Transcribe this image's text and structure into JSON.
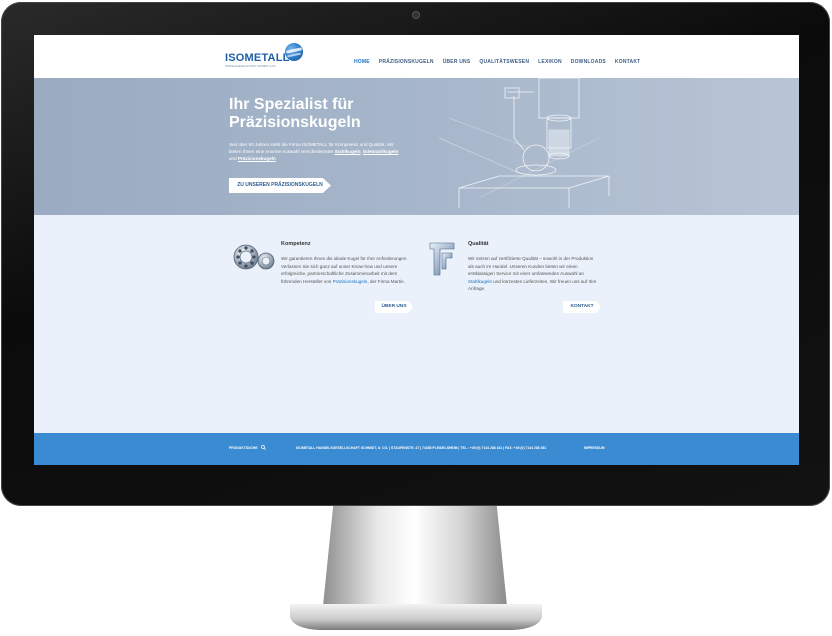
{
  "site": {
    "logo": {
      "name": "ISOMETALL",
      "tagline": "HANDELSGESELLSCHAFT SCHMIDT & CO."
    },
    "nav": [
      {
        "label": "HOME",
        "active": true
      },
      {
        "label": "PRÄZISIONSKUGELN",
        "active": false
      },
      {
        "label": "ÜBER UNS",
        "active": false
      },
      {
        "label": "QUALITÄTSWESEN",
        "active": false
      },
      {
        "label": "LEXIKON",
        "active": false
      },
      {
        "label": "DOWNLOADS",
        "active": false
      },
      {
        "label": "KONTAKT",
        "active": false
      }
    ],
    "hero": {
      "title_line1": "Ihr Spezialist für",
      "title_line2": "Präzisionskugeln",
      "text": "Seit über 50 Jahren steht die Firma ISOMETALL für Kompetenz und Qualität. Wir bieten Ihnen eine enorme Auswahl verschiedenster",
      "link1": "Stahlkugeln",
      "sep1": ", ",
      "link2": "Edelstahlkugeln",
      "sep2": " und ",
      "link3": "Präzisionskugeln",
      "end": ".",
      "button": "ZU UNSEREN PRÄZISIONSKUGELN"
    },
    "features": [
      {
        "title": "Kompetenz",
        "text_pre": "Wir garantieren Ihnen die ideale Kugel für Ihre Anforderungen. Verlassen Sie sich ganz auf unser Know-how und unsere erfolgreiche, partnerschaftliche Zusammenarbeit mit dem führenden Hersteller von ",
        "link": "Präzisionskugeln",
        "text_post": ", der Firma Martin.",
        "button": "ÜBER UNS"
      },
      {
        "title": "Qualität",
        "text_pre": "Wir setzen auf zertifizierte Qualität – sowohl in der Produktion als auch im Handel. Unseren Kunden bieten wir einen erstklassigen Service mit einer umfassenden Auswahl an ",
        "link": "Stahlkugeln",
        "text_post": " und kürzesten Lieferzeiten. Wir freuen uns auf Ihre Anfrage.",
        "button": "KONTAKT"
      }
    ],
    "footer": {
      "search_label": "PRODUKTSUCHE",
      "address": "ISOMETALL HANDELSGESELLSCHAFT SCHMIDT, U. CO. | STAUFENSTR. 47 | 74385 PLEIDELSHEIM | TEL.: +49 (0) 7144 288 441 | FAX: +49 (0) 7144 288 451",
      "impressum": "IMPRESSUM"
    }
  },
  "colors": {
    "accent": "#1b73c7",
    "hero_bg": "#a8b7cb",
    "footer_bg": "#3b8bd2",
    "content_bg": "#eaf1fa"
  }
}
